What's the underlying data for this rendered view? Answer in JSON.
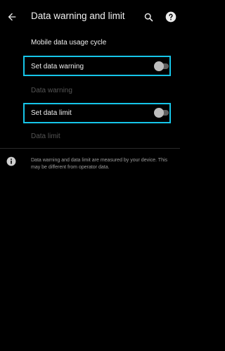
{
  "app_bar": {
    "title": "Data warning and limit"
  },
  "icons": {
    "back": "arrow-back-icon",
    "search": "search-icon",
    "help": "help-icon",
    "info": "info-icon"
  },
  "rows": {
    "usage_cycle": "Mobile data usage cycle",
    "set_warning": {
      "label": "Set data warning",
      "toggle_on": false
    },
    "data_warning": "Data warning",
    "set_limit": {
      "label": "Set data limit",
      "toggle_on": false
    },
    "data_limit": "Data limit"
  },
  "footer": {
    "info_text": "Data warning and data limit are measured by your device. This may be different from operator data."
  },
  "colors": {
    "background": "#000000",
    "highlight": "#16c5e8",
    "disabled_text": "#555555"
  }
}
